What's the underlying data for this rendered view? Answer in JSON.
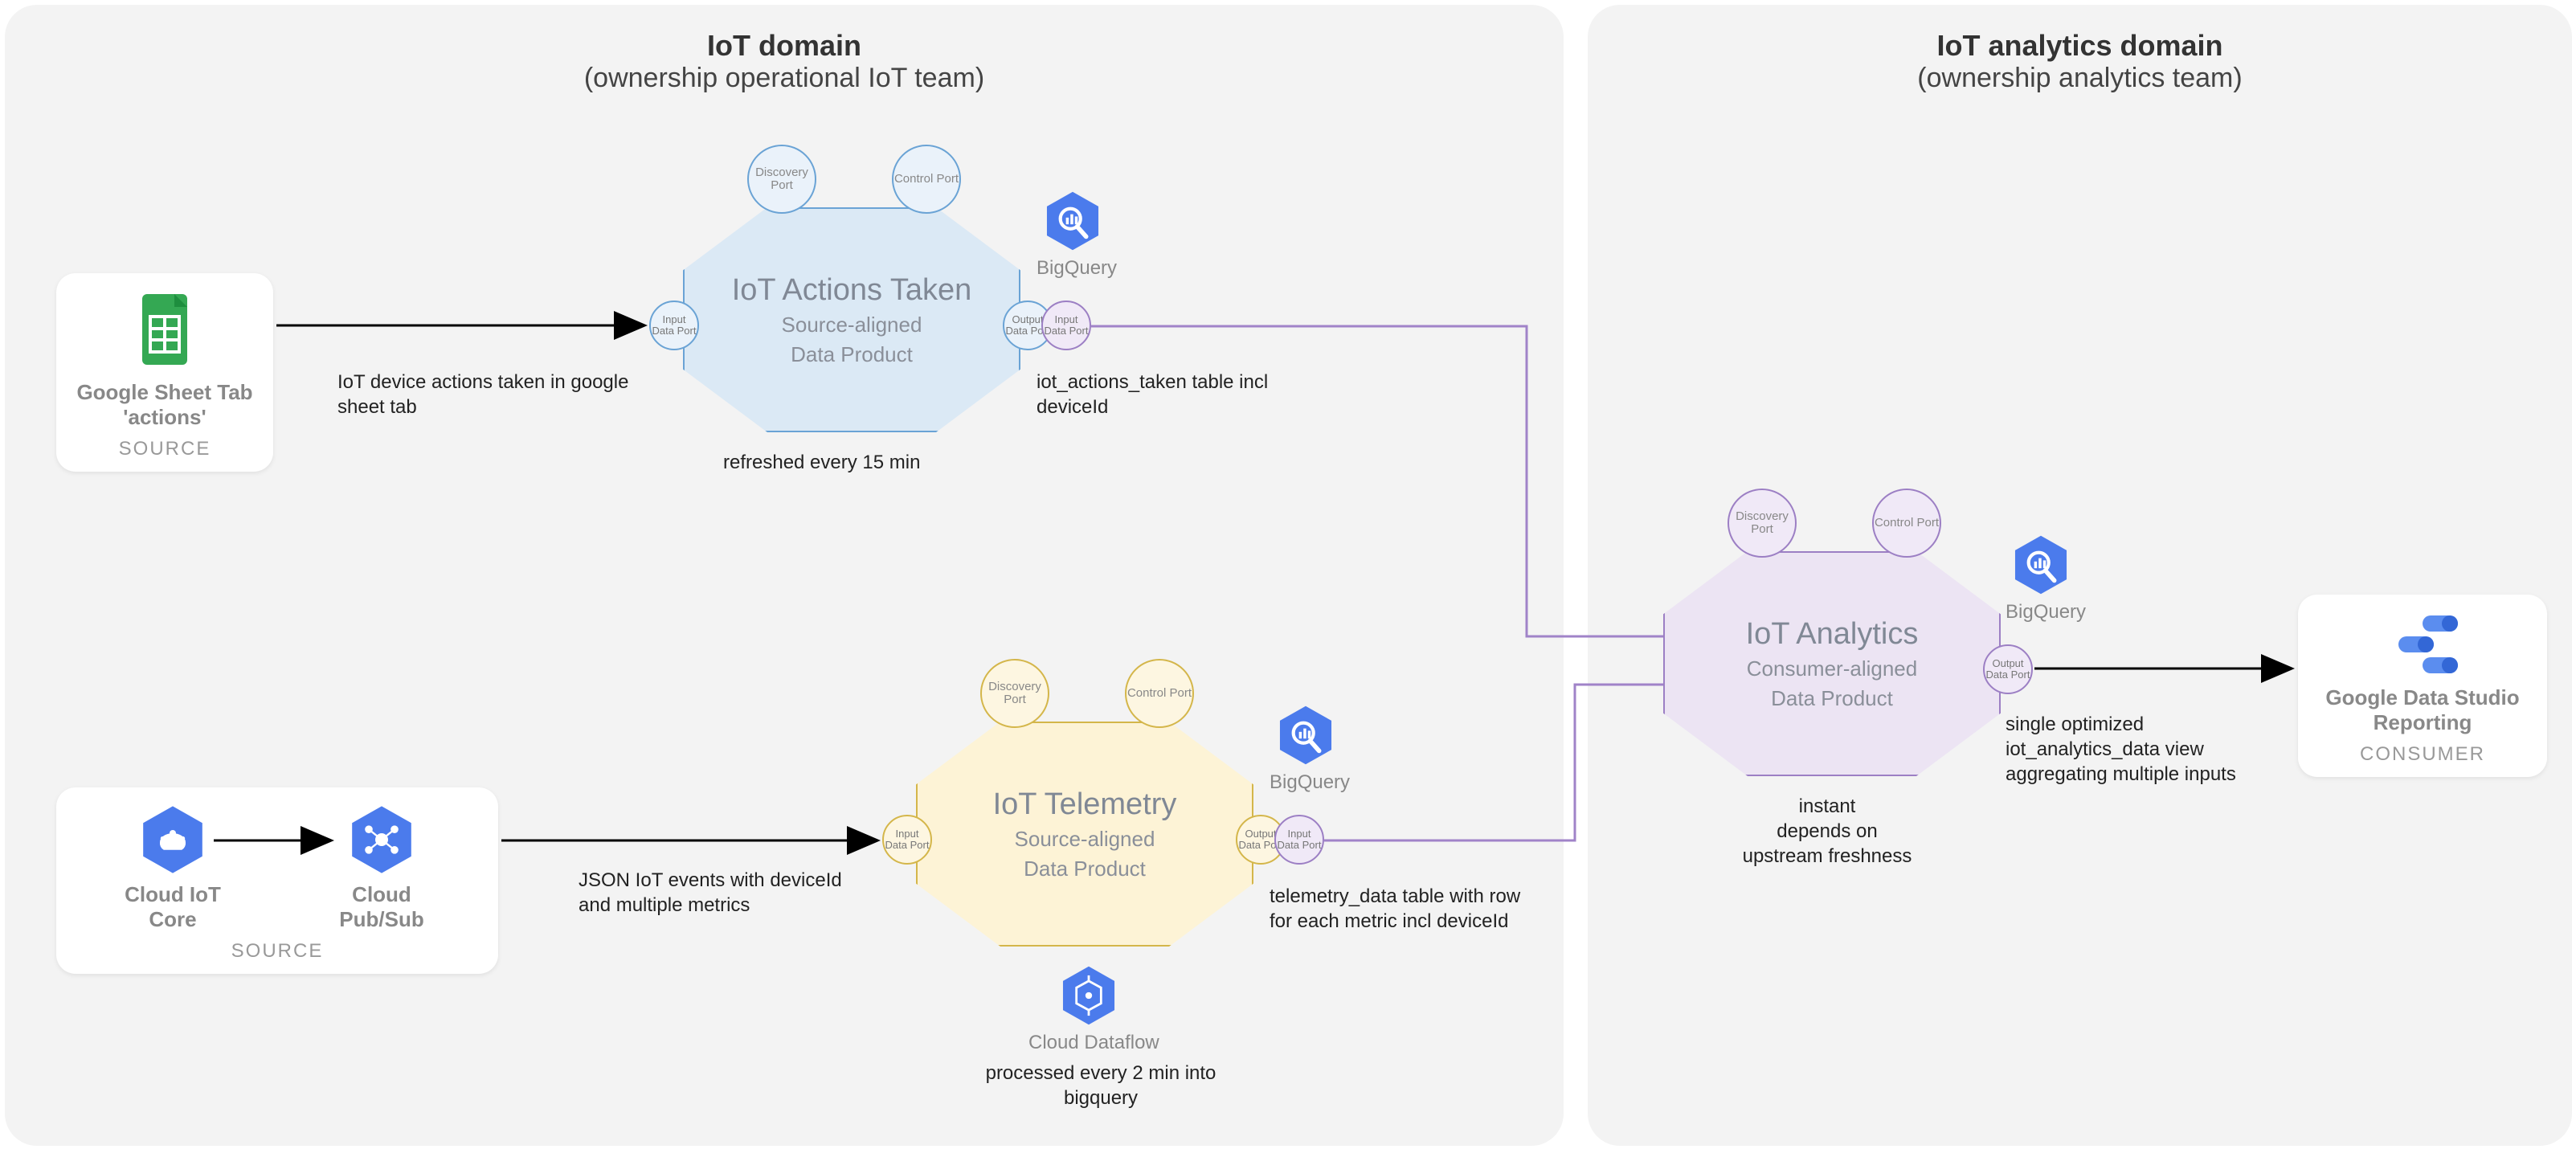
{
  "domain_left": {
    "title": "IoT domain",
    "subtitle": "(ownership operational IoT team)"
  },
  "domain_right": {
    "title": "IoT analytics domain",
    "subtitle": "(ownership analytics team)"
  },
  "source1": {
    "title": "Google Sheet Tab 'actions'",
    "label": "SOURCE"
  },
  "source2": {
    "node1": "Cloud IoT Core",
    "node2": "Cloud Pub/Sub",
    "label": "SOURCE"
  },
  "edge1": "IoT device actions taken in google sheet tab",
  "edge2": "JSON IoT events with deviceId and multiple metrics",
  "product_actions": {
    "title": "IoT Actions Taken",
    "line1": "Source-aligned",
    "line2": "Data Product",
    "discovery": "Discovery Port",
    "control": "Control Port",
    "input": "Input Data Port",
    "output": "Output Data Port",
    "refresh": "refreshed every 15 min",
    "out_service": "BigQuery",
    "out_desc": "iot_actions_taken table incl deviceId"
  },
  "product_telemetry": {
    "title": "IoT Telemetry",
    "line1": "Source-aligned",
    "line2": "Data Product",
    "discovery": "Discovery Port",
    "control": "Control Port",
    "input": "Input Data Port",
    "output": "Output Data Port",
    "out_service": "BigQuery",
    "out_desc": "telemetry_data table with row for each metric incl deviceId",
    "proc_service": "Cloud Dataflow",
    "proc_desc": "processed every 2 min into bigquery"
  },
  "product_analytics": {
    "title": "IoT Analytics",
    "line1": "Consumer-aligned",
    "line2": "Data Product",
    "discovery": "Discovery Port",
    "control": "Control Port",
    "input": "Input Data Port",
    "output": "Output Data Port",
    "out_service": "BigQuery",
    "out_desc": "single optimized iot_analytics_data view aggregating multiple inputs",
    "refresh": "instant\ndepends on\nupstream freshness"
  },
  "consumer": {
    "title": "Google Data Studio Reporting",
    "label": "CONSUMER"
  }
}
